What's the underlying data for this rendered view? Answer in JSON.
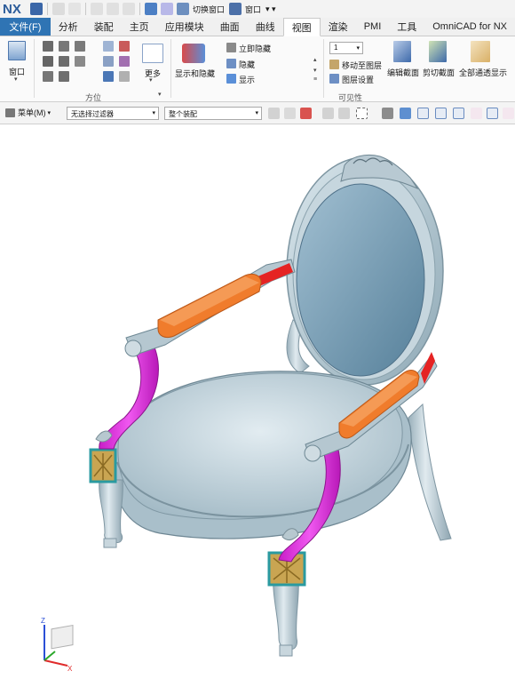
{
  "app": {
    "logo": "NX"
  },
  "quick_access": {
    "switch_window": "切换窗口",
    "window_menu": "窗口"
  },
  "tabs": [
    {
      "label": "文件(F)"
    },
    {
      "label": "分析"
    },
    {
      "label": "装配"
    },
    {
      "label": "主页"
    },
    {
      "label": "应用模块"
    },
    {
      "label": "曲面"
    },
    {
      "label": "曲线"
    },
    {
      "label": "视图"
    },
    {
      "label": "渲染"
    },
    {
      "label": "PMI"
    },
    {
      "label": "工具"
    },
    {
      "label": "OmniCAD for NX"
    }
  ],
  "active_tab": "视图",
  "ribbon": {
    "window_label": "窗口",
    "more_label": "更多",
    "orientation_group": "方位",
    "show_hide_label": "显示和隐藏",
    "immediate_hide": "立即隐藏",
    "hide": "隐藏",
    "show": "显示",
    "layer_value": "1",
    "move_to_layer": "移动至图层",
    "layer_settings": "图层设置",
    "visibility_group": "可见性",
    "edit_section": "编辑截面",
    "clip_section": "剪切截面",
    "show_all_through": "全部通透显示"
  },
  "selection_bar": {
    "menu_label": "菜单(M)",
    "filter_value": "无选择过滤器",
    "scope_value": "整个装配"
  },
  "triad": {
    "x": "X",
    "y": "Y",
    "z": "Z"
  },
  "colors": {
    "accent_blue": "#2f74b4",
    "chair_body": "#a7bfca",
    "back_cushion": "#6f98b0",
    "arm_pad": "#f07c2c",
    "support_magenta": "#e437e4",
    "block_gold": "#c9a552",
    "highlight_red": "#e52323"
  }
}
